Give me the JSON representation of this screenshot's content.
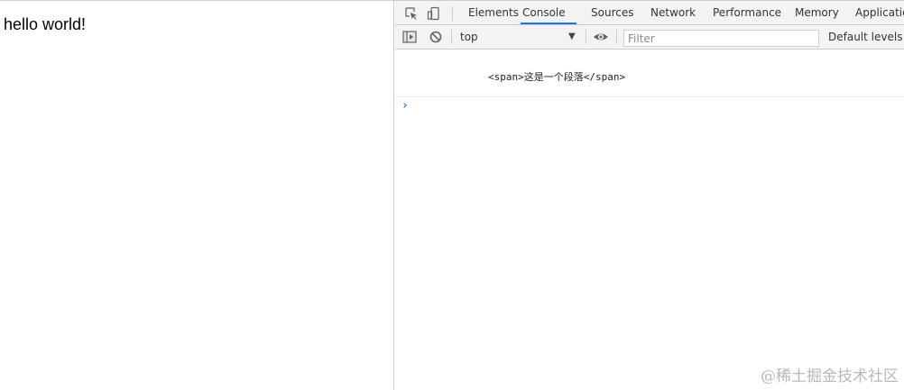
{
  "page": {
    "content_text": "hello world!"
  },
  "devtools": {
    "tabs": [
      {
        "label": "Elements"
      },
      {
        "label": "Console"
      },
      {
        "label": "Sources"
      },
      {
        "label": "Network"
      },
      {
        "label": "Performance"
      },
      {
        "label": "Memory"
      },
      {
        "label": "Applicatio"
      }
    ],
    "active_tab": "Console",
    "toolbar": {
      "context": "top",
      "filter_placeholder": "Filter",
      "levels": "Default levels ▼"
    },
    "console": {
      "messages": [
        {
          "text": "<span>这是一个段落</span>"
        }
      ]
    },
    "icons": {
      "inspect": "inspect-element-icon",
      "device": "device-toolbar-icon",
      "sidebar": "console-sidebar-icon",
      "clear": "clear-console-icon",
      "eye": "live-expression-icon",
      "prompt": "console-prompt-icon"
    },
    "accent_color": "#1a73e8"
  },
  "watermark": "@稀土掘金技术社区"
}
